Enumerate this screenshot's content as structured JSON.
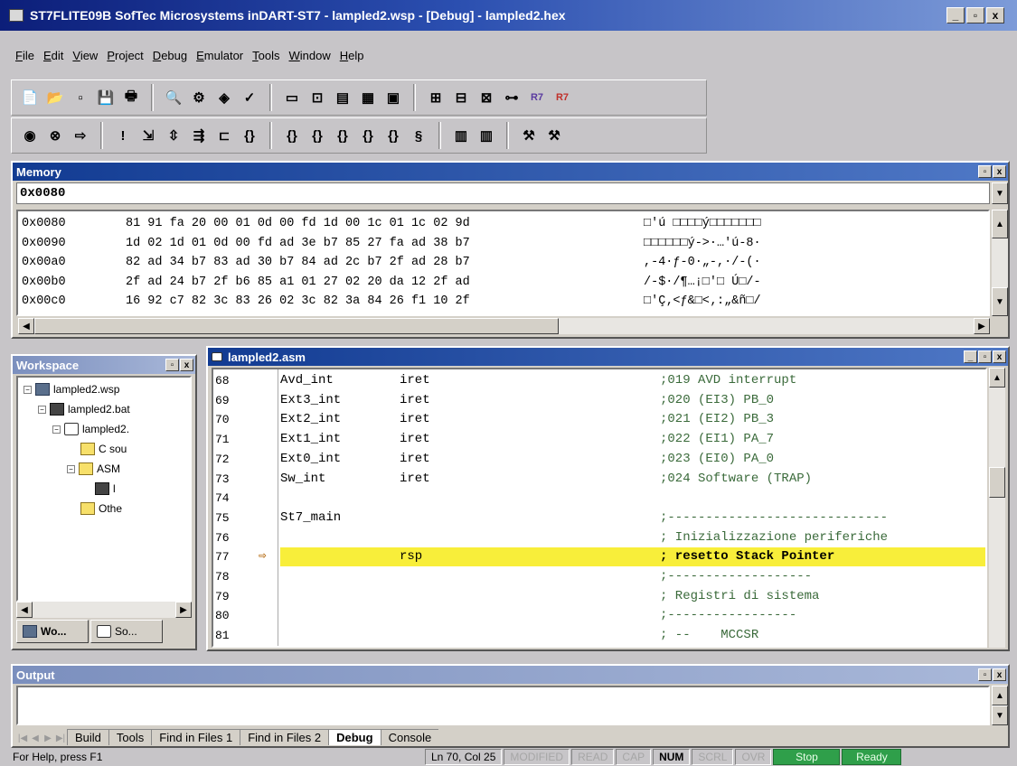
{
  "window": {
    "title": "ST7FLITE09B SofTec Microsystems  inDART-ST7 - lampled2.wsp - [Debug] - lampled2.hex",
    "controls": [
      "_",
      "▫",
      "x"
    ]
  },
  "menu": [
    "File",
    "Edit",
    "View",
    "Project",
    "Debug",
    "Emulator",
    "Tools",
    "Window",
    "Help"
  ],
  "toolbar1": [
    {
      "icon": "new-file-icon",
      "glyph": "📄"
    },
    {
      "icon": "open-folder-icon",
      "glyph": "📂"
    },
    {
      "icon": "window-icon",
      "glyph": "▫"
    },
    {
      "icon": "save-icon",
      "glyph": "💾"
    },
    {
      "icon": "print-icon",
      "glyph": "🖶"
    },
    {
      "icon": "find-icon",
      "glyph": "🔍"
    },
    {
      "icon": "build-icon",
      "glyph": "⚙"
    },
    {
      "icon": "compile-icon",
      "glyph": "◈"
    },
    {
      "icon": "check-icon",
      "glyph": "✓"
    },
    {
      "icon": "view-icon",
      "glyph": "▭"
    },
    {
      "icon": "out-icon",
      "glyph": "⊡"
    },
    {
      "icon": "memory-icon",
      "glyph": "▤"
    },
    {
      "icon": "registers-icon",
      "glyph": "▦"
    },
    {
      "icon": "watch-icon",
      "glyph": "▣"
    },
    {
      "icon": "disasm-icon",
      "glyph": "⊞"
    },
    {
      "icon": "stack-icon",
      "glyph": "⊟"
    },
    {
      "icon": "peripheral-icon",
      "glyph": "⊠"
    },
    {
      "icon": "trace-icon",
      "glyph": "⊶"
    },
    {
      "icon": "r7-icon",
      "glyph": "R7"
    },
    {
      "icon": "r7-red-icon",
      "glyph": "R7"
    }
  ],
  "toolbar2": [
    {
      "icon": "reset-icon",
      "glyph": "◉"
    },
    {
      "icon": "stop-icon",
      "glyph": "⊗"
    },
    {
      "icon": "go-icon",
      "glyph": "⇨"
    },
    {
      "icon": "break-icon",
      "glyph": "!"
    },
    {
      "icon": "step-icon",
      "glyph": "⇲"
    },
    {
      "icon": "step-into-icon",
      "glyph": "⇳"
    },
    {
      "icon": "step-over-icon",
      "glyph": "⇶"
    },
    {
      "icon": "animate-icon",
      "glyph": "⊏"
    },
    {
      "icon": "call-icon",
      "glyph": "{}"
    },
    {
      "icon": "call2-icon",
      "glyph": "{}"
    },
    {
      "icon": "call3-icon",
      "glyph": "{}"
    },
    {
      "icon": "call4-icon",
      "glyph": "{}"
    },
    {
      "icon": "call5-icon",
      "glyph": "{}"
    },
    {
      "icon": "call6-icon",
      "glyph": "{}"
    },
    {
      "icon": "run-to-icon",
      "glyph": "§"
    },
    {
      "icon": "chip-icon",
      "glyph": "▥"
    },
    {
      "icon": "chip2-icon",
      "glyph": "▥"
    },
    {
      "icon": "tool-icon",
      "glyph": "⚒"
    },
    {
      "icon": "tool2-icon",
      "glyph": "⚒"
    }
  ],
  "memory": {
    "title": "Memory",
    "address": "0x0080",
    "rows": [
      {
        "addr": "0x0080",
        "hex": "81 91 fa 20 00 01 0d 00 fd 1d 00 1c 01 1c 02 9d",
        "ascii": "□'ú □□□□ý□□□□□□□"
      },
      {
        "addr": "0x0090",
        "hex": "1d 02 1d 01 0d 00 fd ad 3e b7 85 27 fa ad 38 b7",
        "ascii": "□□□□□□ý->·…'ú-8·"
      },
      {
        "addr": "0x00a0",
        "hex": "82 ad 34 b7 83 ad 30 b7 84 ad 2c b7 2f ad 28 b7",
        "ascii": ",-4·ƒ-0·„-,·/-(·"
      },
      {
        "addr": "0x00b0",
        "hex": "2f ad 24 b7 2f b6 85 a1 01 27 02 20 da 12 2f ad",
        "ascii": "/-$·/¶…¡□'□ Ú□/-"
      },
      {
        "addr": "0x00c0",
        "hex": "16 92 c7 82 3c 83 26 02 3c 82 3a 84 26 f1 10 2f",
        "ascii": "□'Ç‚<ƒ&□<‚:„&ñ□/"
      }
    ]
  },
  "workspace": {
    "title": "Workspace",
    "tree": [
      {
        "label": "lampled2.wsp",
        "level": 0,
        "icon": "workspace-icon",
        "exp": "−"
      },
      {
        "label": "lampled2.bat",
        "level": 1,
        "icon": "batch-file-icon",
        "exp": "−"
      },
      {
        "label": "lampled2.",
        "level": 2,
        "icon": "document-icon",
        "exp": "−"
      },
      {
        "label": "C sou",
        "level": 3,
        "icon": "folder-icon",
        "exp": ""
      },
      {
        "label": "ASM",
        "level": 3,
        "icon": "folder-icon",
        "exp": "−"
      },
      {
        "label": "l",
        "level": 4,
        "icon": "file-icon",
        "exp": ""
      },
      {
        "label": "Othe",
        "level": 3,
        "icon": "folder-icon",
        "exp": ""
      }
    ],
    "tabs": [
      "Wo...",
      "So..."
    ]
  },
  "source": {
    "title": "lampled2.asm",
    "lines": [
      {
        "num": "68",
        "label": "Avd_int",
        "instr": "iret",
        "comment": ";019 AVD interrupt"
      },
      {
        "num": "69",
        "label": "Ext3_int",
        "instr": "iret",
        "comment": ";020 (EI3) PB_0"
      },
      {
        "num": "70",
        "label": "Ext2_int",
        "instr": "iret",
        "comment": ";021 (EI2) PB_3"
      },
      {
        "num": "71",
        "label": "Ext1_int",
        "instr": "iret",
        "comment": ";022 (EI1) PA_7"
      },
      {
        "num": "72",
        "label": "Ext0_int",
        "instr": "iret",
        "comment": ";023 (EI0) PA_0"
      },
      {
        "num": "73",
        "label": "Sw_int",
        "instr": "iret",
        "comment": ";024 Software (TRAP)"
      },
      {
        "num": "74",
        "label": "",
        "instr": "",
        "comment": ""
      },
      {
        "num": "75",
        "label": "St7_main",
        "instr": "",
        "comment": ";-----------------------------"
      },
      {
        "num": "76",
        "label": "",
        "instr": "",
        "comment": "; Inizializzazione periferiche"
      },
      {
        "num": "77",
        "label": "",
        "instr": "rsp",
        "comment": "; resetto Stack Pointer",
        "current": true
      },
      {
        "num": "78",
        "label": "",
        "instr": "",
        "comment": ";-------------------"
      },
      {
        "num": "79",
        "label": "",
        "instr": "",
        "comment": "; Registri di sistema"
      },
      {
        "num": "80",
        "label": "",
        "instr": "",
        "comment": ";-----------------"
      },
      {
        "num": "81",
        "label": "",
        "instr": "",
        "comment": "; --    MCCSR"
      }
    ]
  },
  "output": {
    "title": "Output",
    "tabs": [
      "Build",
      "Tools",
      "Find in Files 1",
      "Find in Files 2",
      "Debug",
      "Console"
    ],
    "active_tab": "Debug"
  },
  "status": {
    "help": "For Help, press F1",
    "position": "Ln 70, Col 25",
    "modified": "MODIFIED",
    "read": "READ",
    "cap": "CAP",
    "num": "NUM",
    "scrl": "SCRL",
    "ovr": "OVR",
    "state": "Stop",
    "ready": "Ready"
  },
  "colors": {
    "title_active": "#0c1e79",
    "highlight_line": "#f8ee3a",
    "status_green": "#2f9f4a"
  }
}
